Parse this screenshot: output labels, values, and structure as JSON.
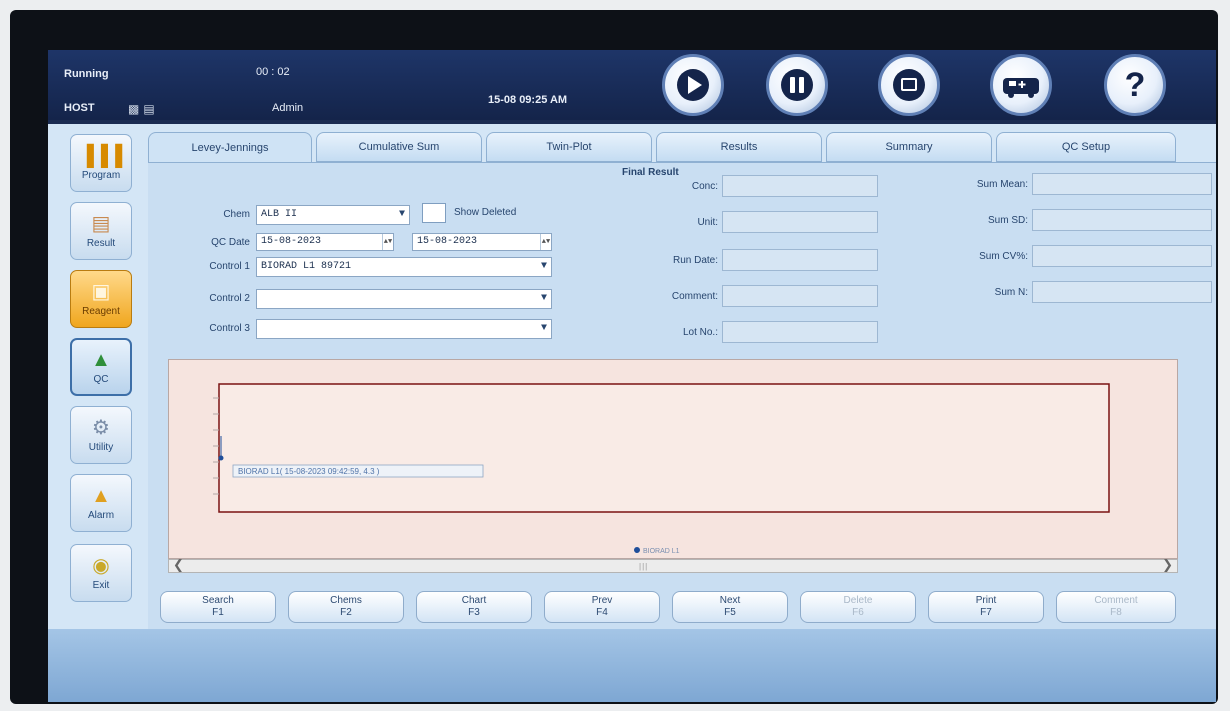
{
  "status": {
    "state": "Running",
    "timer": "00 : 02",
    "host": "HOST",
    "user": "Admin",
    "datetime": "15-08 09:25 AM"
  },
  "toolbar": {
    "icons": [
      "play-icon",
      "pause-icon",
      "screen-icon",
      "ambulance-icon",
      "help-icon"
    ],
    "help_glyph": "?"
  },
  "sidebar": {
    "items": [
      {
        "label": "Program",
        "icon": "program-icon"
      },
      {
        "label": "Result",
        "icon": "result-icon"
      },
      {
        "label": "Reagent",
        "icon": "reagent-icon"
      },
      {
        "label": "QC",
        "icon": "qc-icon"
      },
      {
        "label": "Utility",
        "icon": "utility-icon"
      },
      {
        "label": "Alarm",
        "icon": "alarm-icon"
      },
      {
        "label": "Exit",
        "icon": "exit-icon"
      }
    ]
  },
  "tabs": [
    {
      "label": "Levey-Jennings"
    },
    {
      "label": "Cumulative Sum"
    },
    {
      "label": "Twin-Plot"
    },
    {
      "label": "Results"
    },
    {
      "label": "Summary"
    },
    {
      "label": "QC Setup"
    }
  ],
  "form": {
    "chem_label": "Chem",
    "chem_value": "ALB II",
    "show_deleted_label": "Show Deleted",
    "qc_date_label": "QC Date",
    "qc_date_from": "15-08-2023",
    "qc_date_to": "15-08-2023",
    "control1_label": "Control 1",
    "control1_value": "BIORAD L1 89721",
    "control2_label": "Control 2",
    "control2_value": "",
    "control3_label": "Control 3",
    "control3_value": ""
  },
  "final_result": {
    "title": "Final Result",
    "conc_label": "Conc:",
    "unit_label": "Unit:",
    "run_date_label": "Run Date:",
    "comment_label": "Comment:",
    "lot_label": "Lot No.:"
  },
  "summary_fields": {
    "sum_mean_label": "Sum Mean:",
    "sum_sd_label": "Sum SD:",
    "sum_cv_label": "Sum CV%:",
    "sum_n_label": "Sum N:"
  },
  "chart_data": {
    "type": "line",
    "title": "",
    "xlabel": "",
    "ylabel": "",
    "series": [
      {
        "name": "BIORAD L1",
        "points": [
          {
            "x": "15-08-2023 09:42:59",
            "y": 4.3
          }
        ]
      }
    ],
    "point_label": "BIORAD L1( 15-08-2023 09:42:59, 4.3 )",
    "legend": [
      "BIORAD L1"
    ],
    "legend_position": "bottom-center"
  },
  "function_buttons": [
    {
      "label": "Search",
      "key": "F1",
      "enabled": true
    },
    {
      "label": "Chems",
      "key": "F2",
      "enabled": true
    },
    {
      "label": "Chart",
      "key": "F3",
      "enabled": true
    },
    {
      "label": "Prev",
      "key": "F4",
      "enabled": true
    },
    {
      "label": "Next",
      "key": "F5",
      "enabled": true
    },
    {
      "label": "Delete",
      "key": "F6",
      "enabled": false
    },
    {
      "label": "Print",
      "key": "F7",
      "enabled": true
    },
    {
      "label": "Comment",
      "key": "F8",
      "enabled": false
    }
  ],
  "colors": {
    "header": "#14244a",
    "panel": "#d4e6f6",
    "chart_bg": "#f6e4df",
    "chart_border": "#7a1212",
    "point": "#1f4e9a",
    "active_nav": "#f0a61e"
  }
}
